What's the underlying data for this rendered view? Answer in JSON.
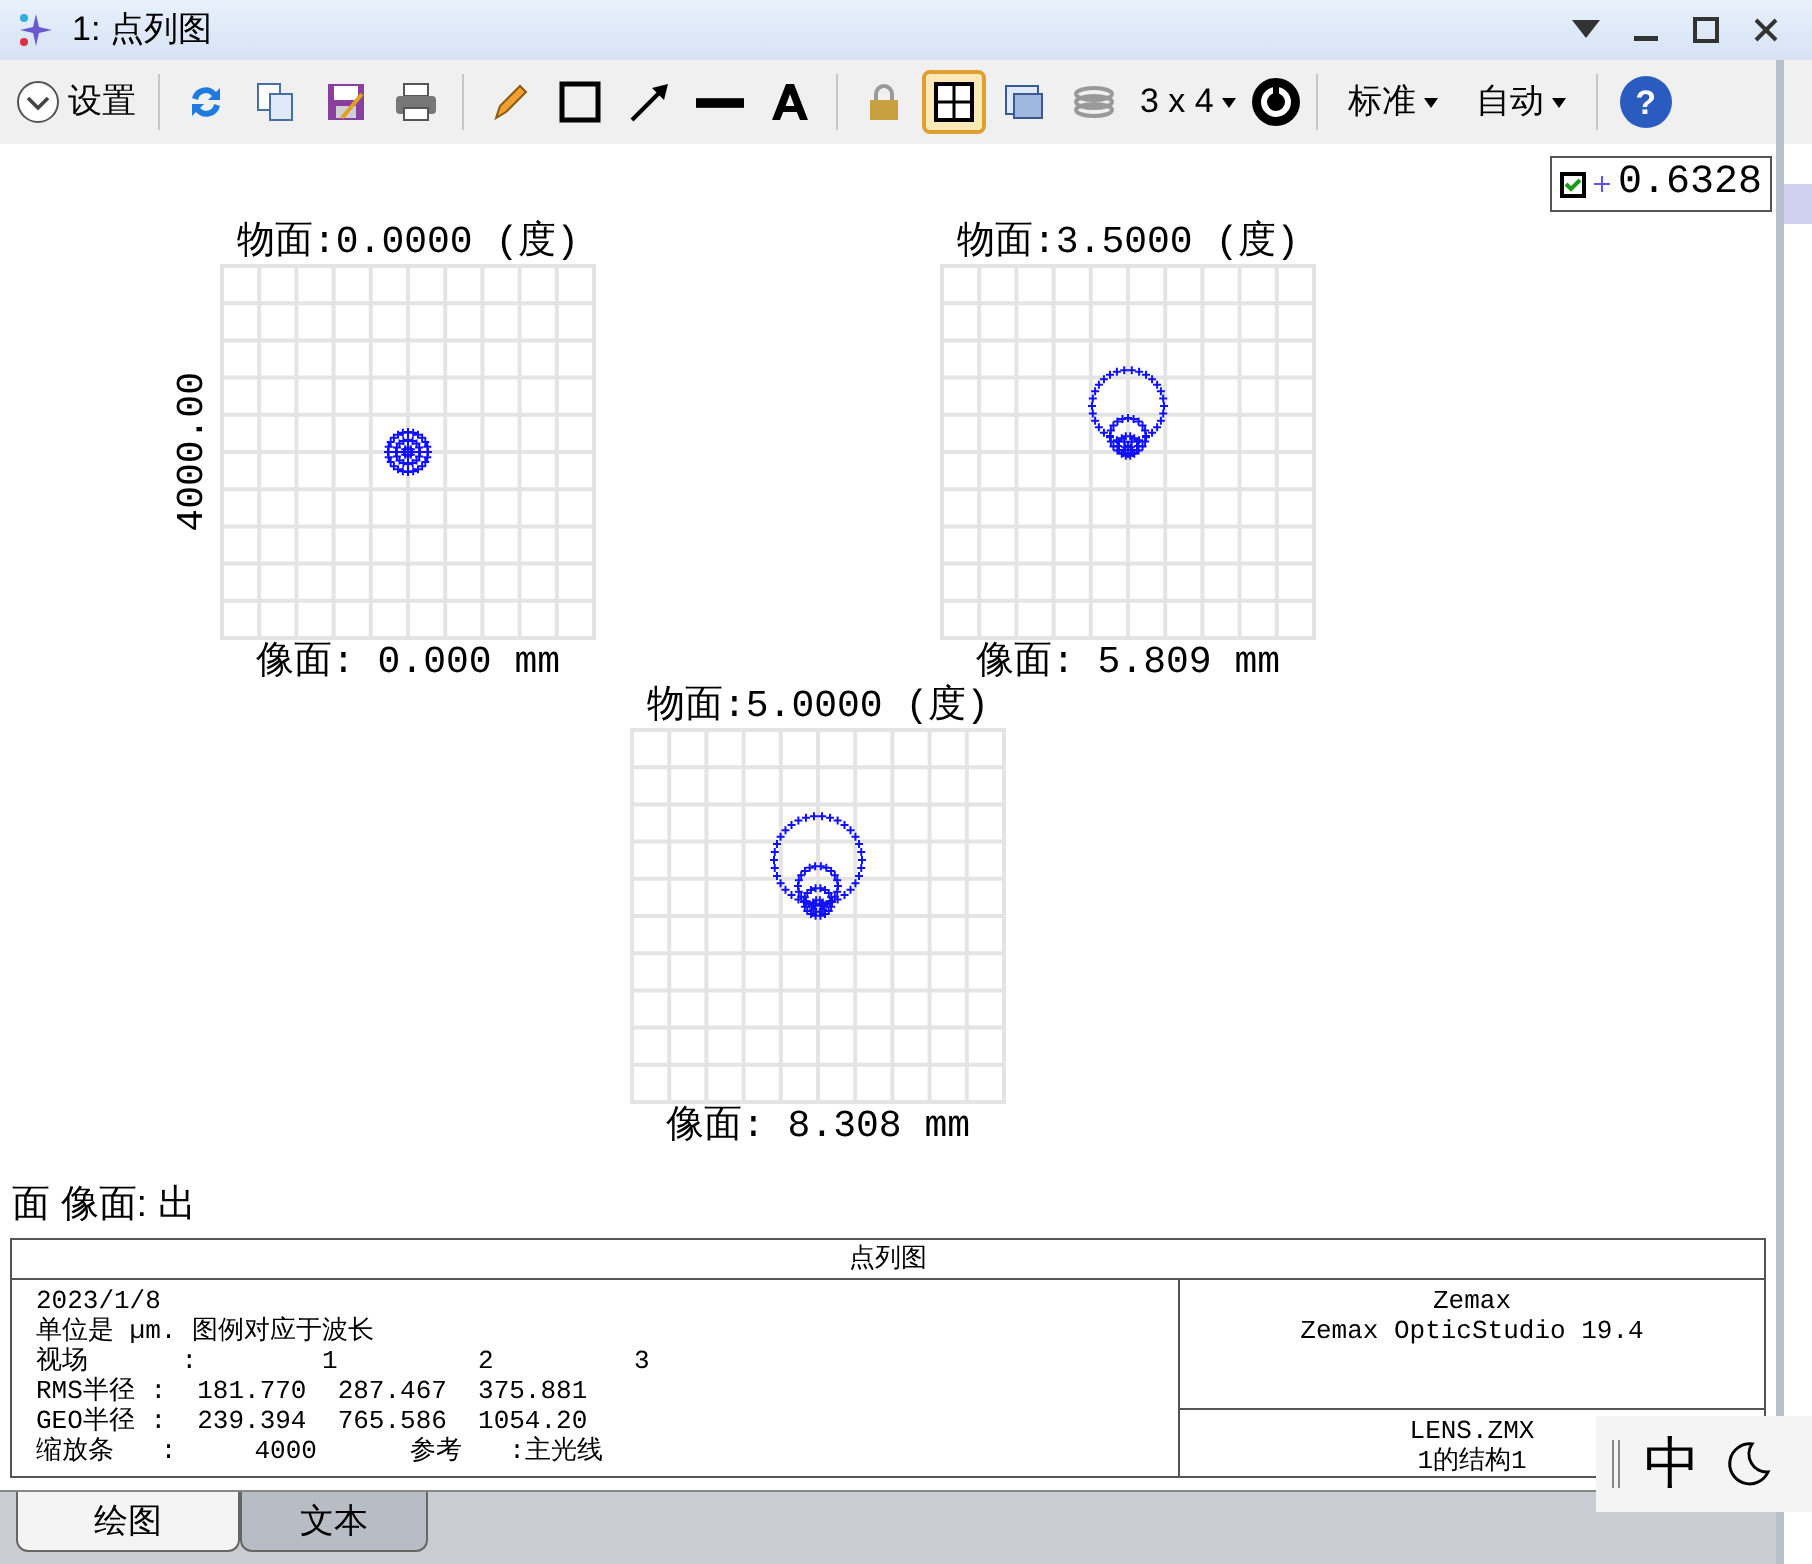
{
  "window": {
    "title": "1: 点列图"
  },
  "toolbar": {
    "settings_label": "设置",
    "layout_label": "3 x 4",
    "dropdowns": [
      "标准",
      "自动"
    ],
    "help_label": "?",
    "icon_buttons": [
      {
        "kind": "refresh",
        "selected": false
      },
      {
        "kind": "copy",
        "selected": false
      },
      {
        "kind": "save",
        "selected": false
      },
      {
        "kind": "print",
        "selected": false
      },
      {
        "kind": "pencil",
        "selected": false
      },
      {
        "kind": "rectangle",
        "selected": false
      },
      {
        "kind": "arrow",
        "selected": false
      },
      {
        "kind": "line",
        "selected": false
      },
      {
        "kind": "text",
        "selected": false
      },
      {
        "kind": "lock",
        "selected": false
      },
      {
        "kind": "grid",
        "selected": true
      },
      {
        "kind": "window",
        "selected": false
      },
      {
        "kind": "layers",
        "selected": false
      }
    ]
  },
  "legend": {
    "checked": true,
    "label": "0.6328"
  },
  "scale_bar": "4000.00",
  "plots": [
    {
      "title": "物面:0.0000 (度)",
      "caption": "像面: 0.000 mm",
      "kind": "round"
    },
    {
      "title": "物面:3.5000 (度)",
      "caption": "像面: 5.809 mm",
      "kind": "comet-small"
    },
    {
      "title": "物面:5.0000 (度)",
      "caption": "像面: 8.308 mm",
      "kind": "comet-large"
    }
  ],
  "surface_line": "面 像面: 出",
  "info": {
    "heading": "点列图",
    "lines": [
      "2023/1/8",
      "单位是 µm. 图例对应于波长",
      "视场      :        1         2         3",
      "RMS半径 :  181.770  287.467  375.881",
      "GEO半径 :  239.394  765.586  1054.20",
      "缩放条   :     4000      参考   :主光线"
    ],
    "brand": [
      "Zemax",
      "Zemax OpticStudio 19.4"
    ],
    "file": [
      "LENS.ZMX",
      "1的结构1"
    ]
  },
  "tabs": [
    {
      "label": "绘图",
      "selected": true
    },
    {
      "label": "文本",
      "selected": false
    }
  ],
  "ime": {
    "label": "中"
  }
}
